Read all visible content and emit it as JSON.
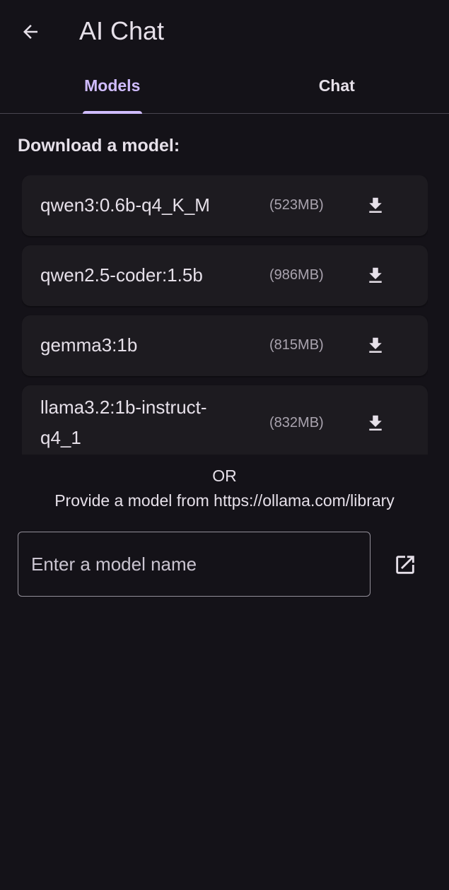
{
  "appbar": {
    "title": "AI Chat",
    "back_icon": "arrow-back-icon"
  },
  "tabs": [
    {
      "label": "Models",
      "active": true
    },
    {
      "label": "Chat",
      "active": false
    }
  ],
  "download_section": {
    "heading": "Download a model:",
    "models": [
      {
        "name": "qwen3:0.6b-q4_K_M",
        "size": "(523MB)",
        "icon": "download-icon"
      },
      {
        "name": "qwen2.5-coder:1.5b",
        "size": "(986MB)",
        "icon": "download-icon"
      },
      {
        "name": "gemma3:1b",
        "size": "(815MB)",
        "icon": "download-icon"
      },
      {
        "name": "llama3.2:1b-instruct-q4_1",
        "size": "(832MB)",
        "icon": "download-icon"
      }
    ]
  },
  "alternative": {
    "or_text": "OR",
    "provide_text": "Provide a model from https://ollama.com/library"
  },
  "input": {
    "placeholder": "Enter a model name",
    "value": "",
    "open_link_icon": "open-in-new-icon"
  },
  "colors": {
    "background": "#141218",
    "surface": "#1d1b20",
    "accent": "#d0bcff",
    "text": "#e6e0e9",
    "muted": "#a9a3ae"
  }
}
